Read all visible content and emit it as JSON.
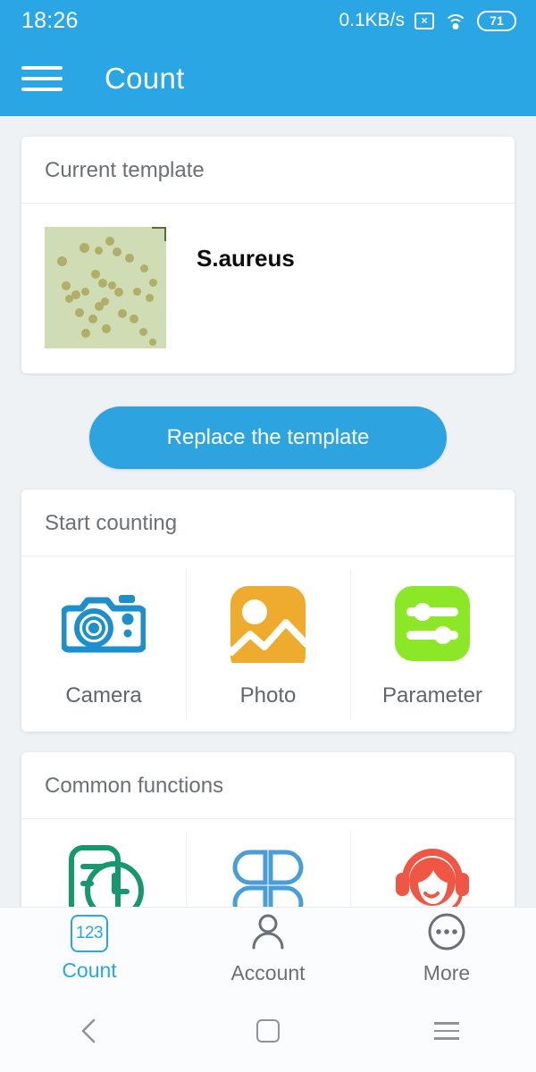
{
  "status_bar": {
    "time": "18:26",
    "network_speed": "0.1KB/s",
    "xbox_icon": "x-box-icon",
    "xbox_glyph": "×",
    "wifi_icon": "wifi-icon",
    "battery_icon": "battery-icon",
    "battery_level": "71"
  },
  "app_bar": {
    "menu_icon": "hamburger-menu-icon",
    "title": "Count"
  },
  "template_card": {
    "header": "Current template",
    "thumbnail_icon": "agar-plate-thumbnail",
    "name": "S.aureus"
  },
  "replace_button": {
    "label": "Replace the template"
  },
  "start_counting": {
    "header": "Start counting",
    "items": [
      {
        "label": "Camera",
        "icon": "camera-icon",
        "color": "#1e8fcd"
      },
      {
        "label": "Photo",
        "icon": "photo-icon",
        "color": "#eeab2e"
      },
      {
        "label": "Parameter",
        "icon": "parameter-sliders-icon",
        "color": "#8ce827"
      }
    ]
  },
  "common_functions": {
    "header": "Common functions",
    "items": [
      {
        "label": "",
        "icon": "history-record-icon",
        "color": "#17976d"
      },
      {
        "label": "",
        "icon": "four-petal-grid-icon",
        "color": "#4a9ed8"
      },
      {
        "label": "",
        "icon": "customer-service-icon",
        "color": "#ef5744"
      }
    ]
  },
  "tab_bar": {
    "tabs": [
      {
        "label": "Count",
        "icon": "count-123-icon",
        "badge": "123",
        "active": true
      },
      {
        "label": "Account",
        "icon": "person-icon",
        "active": false
      },
      {
        "label": "More",
        "icon": "more-dots-icon",
        "active": false
      }
    ]
  },
  "nav_bar": {
    "back_icon": "back-chevron-icon",
    "home_icon": "home-square-icon",
    "recents_icon": "recents-lines-icon"
  },
  "colors": {
    "accent": "#2aa6e4",
    "page_bg": "#eef2f5",
    "card_bg": "#ffffff",
    "text_muted": "#6b7076"
  }
}
